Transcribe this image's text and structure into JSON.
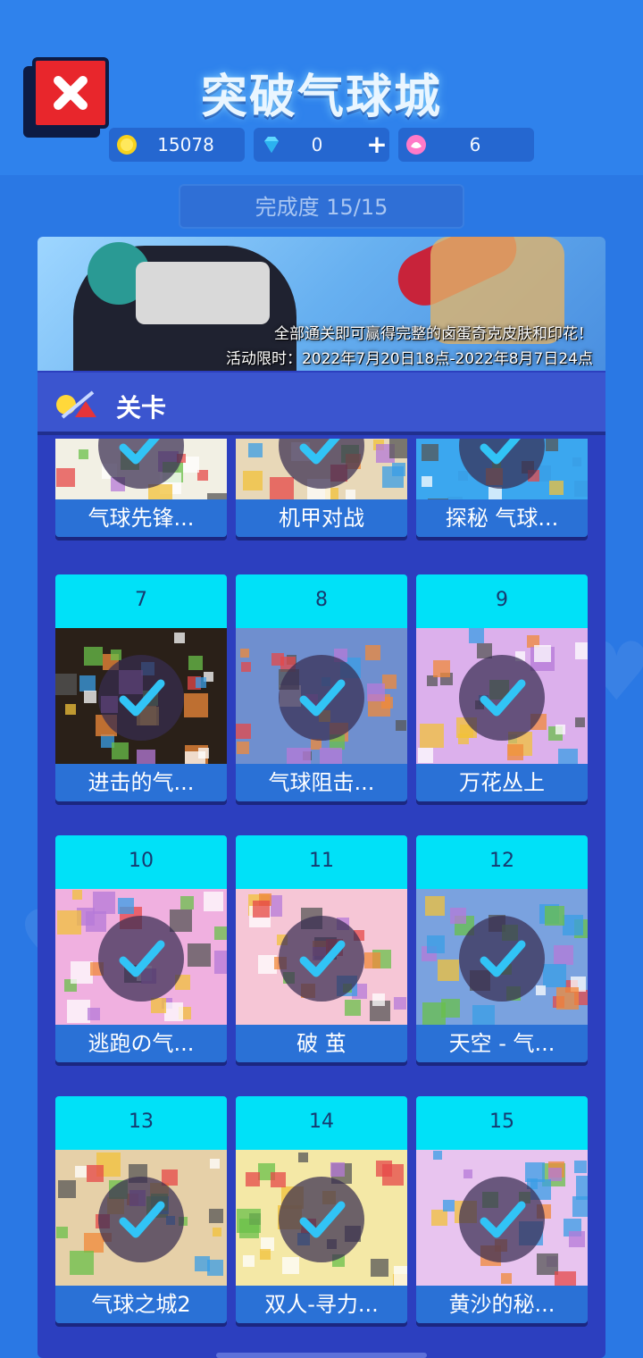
{
  "header": {
    "title": "突破气球城",
    "close_icon": "close-icon",
    "coins": "15078",
    "gems": "0",
    "tickets": "6",
    "plus_label": "+"
  },
  "progress": {
    "label": "完成度 15/15"
  },
  "banner": {
    "line1": "全部通关即可赢得完整的卤蛋奇克皮肤和印花！",
    "line2": "活动限时：2022年7月20日18点-2022年8月7日24点"
  },
  "section": {
    "label": "关卡"
  },
  "levels": [
    {
      "num": "",
      "name": "气球先锋...",
      "done": true,
      "theme": "#f2f0e4"
    },
    {
      "num": "",
      "name": "机甲对战",
      "done": true,
      "theme": "#e8d8b8"
    },
    {
      "num": "",
      "name": "探秘 气球...",
      "done": true,
      "theme": "#3ba7ef"
    },
    {
      "num": "7",
      "name": "进击的气...",
      "done": true,
      "theme": "#2a2018"
    },
    {
      "num": "8",
      "name": "气球阻击...",
      "done": true,
      "theme": "#6f8fcf"
    },
    {
      "num": "9",
      "name": "万花丛上",
      "done": true,
      "theme": "#dcb0ec"
    },
    {
      "num": "10",
      "name": "逃跑の气...",
      "done": true,
      "theme": "#f0b0e0"
    },
    {
      "num": "11",
      "name": "破 茧",
      "done": true,
      "theme": "#f6c6d6"
    },
    {
      "num": "12",
      "name": "天空 - 气...",
      "done": true,
      "theme": "#7aa2df"
    },
    {
      "num": "13",
      "name": "气球之城2",
      "done": true,
      "theme": "#e6d0a8"
    },
    {
      "num": "14",
      "name": "双人-寻力...",
      "done": true,
      "theme": "#f4e8a6"
    },
    {
      "num": "15",
      "name": "黄沙的秘...",
      "done": true,
      "theme": "#e8c4ef"
    }
  ],
  "colors": {
    "accent": "#00e1f8",
    "check": "#31c4f6",
    "close": "#e8262c"
  }
}
